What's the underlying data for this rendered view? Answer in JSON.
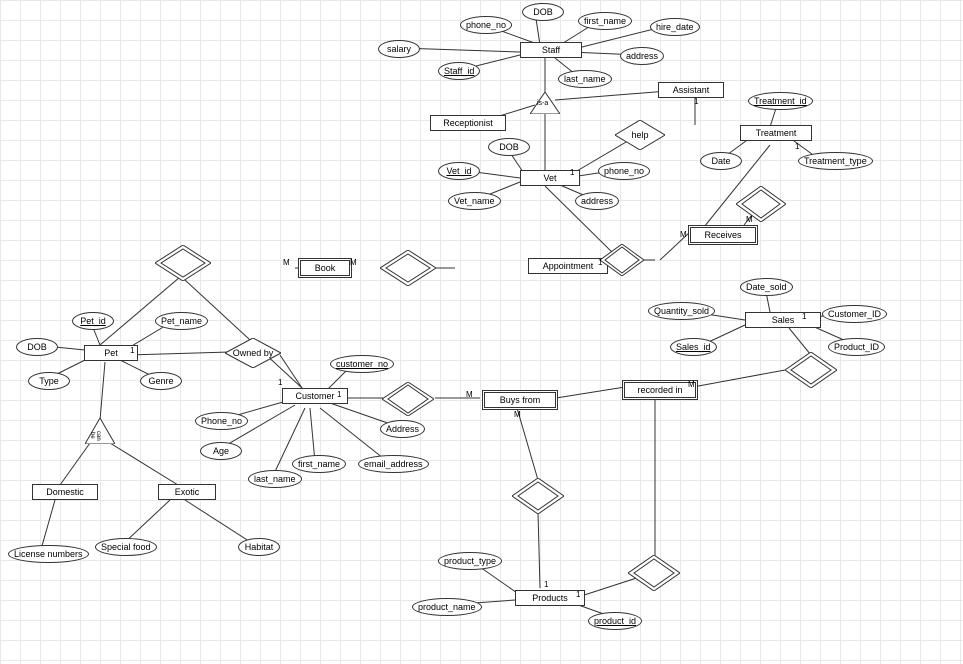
{
  "entities": {
    "staff": "Staff",
    "assistant": "Assistant",
    "receptionist": "Receptionist",
    "vet": "Vet",
    "treatment": "Treatment",
    "appointment": "Appointment",
    "book": "Book",
    "pet": "Pet",
    "customer": "Customer",
    "domestic": "Domestic",
    "exotic": "Exotic",
    "products": "Products",
    "sales": "Sales",
    "buys_from": "Buys from",
    "recorded_in": "recorded in",
    "receives": "Receives"
  },
  "attrs": {
    "staff_phone": "phone_no",
    "staff_dob": "DOB",
    "staff_first": "first_name",
    "staff_hire": "hire_date",
    "staff_salary": "salary",
    "staff_id": "Staff_id",
    "staff_last": "last_name",
    "staff_addr": "address",
    "vet_dob": "DOB",
    "vet_id": "Vet_id",
    "vet_name": "Vet_name",
    "vet_addr": "address",
    "vet_phone": "phone_no",
    "treatment_id": "Treatment_id",
    "treatment_type": "Treatment_type",
    "treatment_date": "Date",
    "pet_id": "Pet_id",
    "pet_name": "Pet_name",
    "pet_dob": "DOB",
    "pet_type": "Type",
    "pet_genre": "Genre",
    "cust_no": "customer_no",
    "cust_phone": "Phone_no",
    "cust_age": "Age",
    "cust_first": "first_name",
    "cust_last": "last_name",
    "cust_addr": "Address",
    "cust_email": "email_address",
    "dom_license": "License numbers",
    "ex_food": "Special food",
    "ex_habitat": "Habitat",
    "prod_type": "product_type",
    "prod_name": "product_name",
    "prod_id": "product_id",
    "sales_qty": "Quantity_sold",
    "sales_id": "Sales_id",
    "sales_date": "Date_sold",
    "sales_cust": "Customer_ID",
    "sales_prod": "Product_ID"
  },
  "rels": {
    "isa_staff": "is-a",
    "help": "help",
    "owned_by": "Owned by",
    "can_be": "can be"
  },
  "card": {
    "one": "1",
    "many": "M"
  }
}
